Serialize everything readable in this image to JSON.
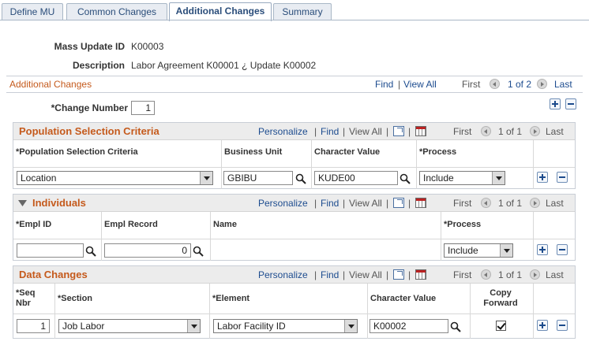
{
  "tabs": [
    "Define MU",
    "Common Changes",
    "Additional Changes",
    "Summary"
  ],
  "header": {
    "mass_update_id_label": "Mass Update ID",
    "mass_update_id": "K00003",
    "description_label": "Description",
    "description": "Labor Agreement K00001 ¿ Update K00002"
  },
  "additional": {
    "title": "Additional Changes",
    "find": "Find",
    "view_all": "View All",
    "first": "First",
    "count": "1 of 2",
    "last": "Last",
    "change_number_label": "*Change Number",
    "change_number": "1"
  },
  "population": {
    "title": "Population Selection Criteria",
    "personalize": "Personalize",
    "find": "Find",
    "view_all": "View All",
    "first": "First",
    "count": "1 of 1",
    "last": "Last",
    "columns": [
      "*Population Selection Criteria",
      "Business Unit",
      "Character Value",
      "*Process"
    ],
    "row": {
      "criteria": "Location",
      "business_unit": "GBIBU",
      "character_value": "KUDE00",
      "process": "Include"
    }
  },
  "individuals": {
    "title": "Individuals",
    "personalize": "Personalize",
    "find": "Find",
    "view_all": "View All",
    "first": "First",
    "count": "1 of 1",
    "last": "Last",
    "columns": [
      "*Empl ID",
      "Empl Record",
      "Name",
      "*Process"
    ],
    "row": {
      "empl_id": "",
      "empl_record": "0",
      "name": "",
      "process": "Include"
    }
  },
  "data_changes": {
    "title": "Data Changes",
    "personalize": "Personalize",
    "find": "Find",
    "view_all": "View All",
    "first": "First",
    "count": "1 of 1",
    "last": "Last",
    "columns": [
      "*Seq",
      "Nbr",
      "*Section",
      "*Element",
      "Character Value",
      "Copy",
      "Forward"
    ],
    "row": {
      "seq": "1",
      "section": "Job Labor",
      "element": "Labor Facility ID",
      "character_value": "K00002",
      "copy_forward": true
    }
  },
  "colors": {
    "accent": "#c55a1c",
    "link": "#1d4c8f"
  }
}
